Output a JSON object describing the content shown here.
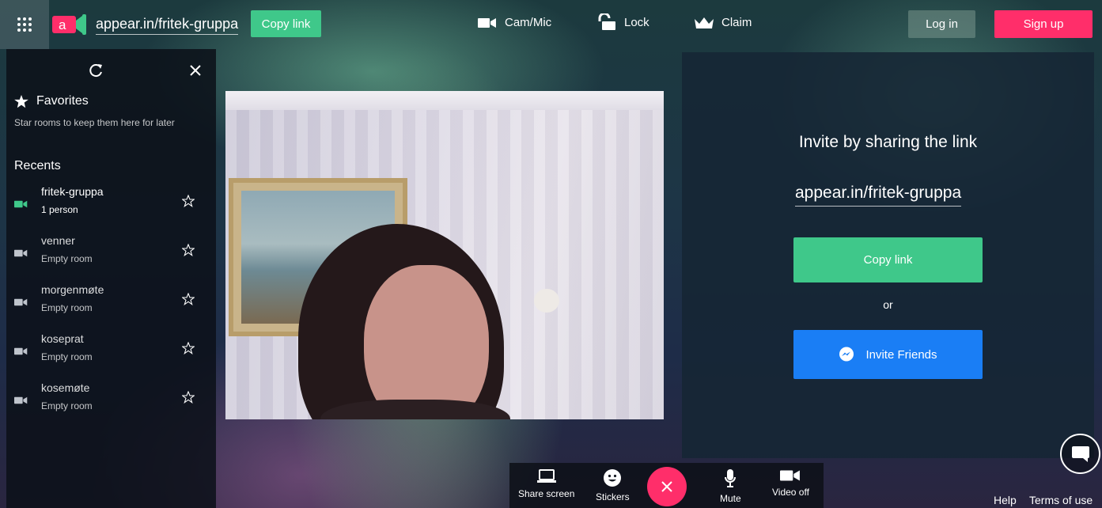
{
  "topbar": {
    "room_url": "appear.in/fritek-gruppa",
    "copy_link_label": "Copy link",
    "cam_mic_label": "Cam/Mic",
    "lock_label": "Lock",
    "claim_label": "Claim",
    "login_label": "Log in",
    "signup_label": "Sign up",
    "logo_letter": "a"
  },
  "sidebar": {
    "favorites_title": "Favorites",
    "favorites_hint": "Star rooms to keep them here for later",
    "recents_title": "Recents",
    "recents": [
      {
        "name": "fritek-gruppa",
        "status": "1 person",
        "active": true
      },
      {
        "name": "venner",
        "status": "Empty room",
        "active": false
      },
      {
        "name": "morgenmøte",
        "status": "Empty room",
        "active": false
      },
      {
        "name": "koseprat",
        "status": "Empty room",
        "active": false
      },
      {
        "name": "kosemøte",
        "status": "Empty room",
        "active": false
      }
    ]
  },
  "invite": {
    "title": "Invite by sharing the link",
    "url": "appear.in/fritek-gruppa",
    "copy_label": "Copy link",
    "or_label": "or",
    "friends_label": "Invite Friends"
  },
  "controls": {
    "share_screen": "Share screen",
    "stickers": "Stickers",
    "mute": "Mute",
    "video_off": "Video off"
  },
  "footer": {
    "help": "Help",
    "terms": "Terms of use"
  },
  "colors": {
    "green": "#3fc88a",
    "pink": "#ff2e6a",
    "blue": "#1a7ef5",
    "active_cam": "#3fc88a"
  }
}
